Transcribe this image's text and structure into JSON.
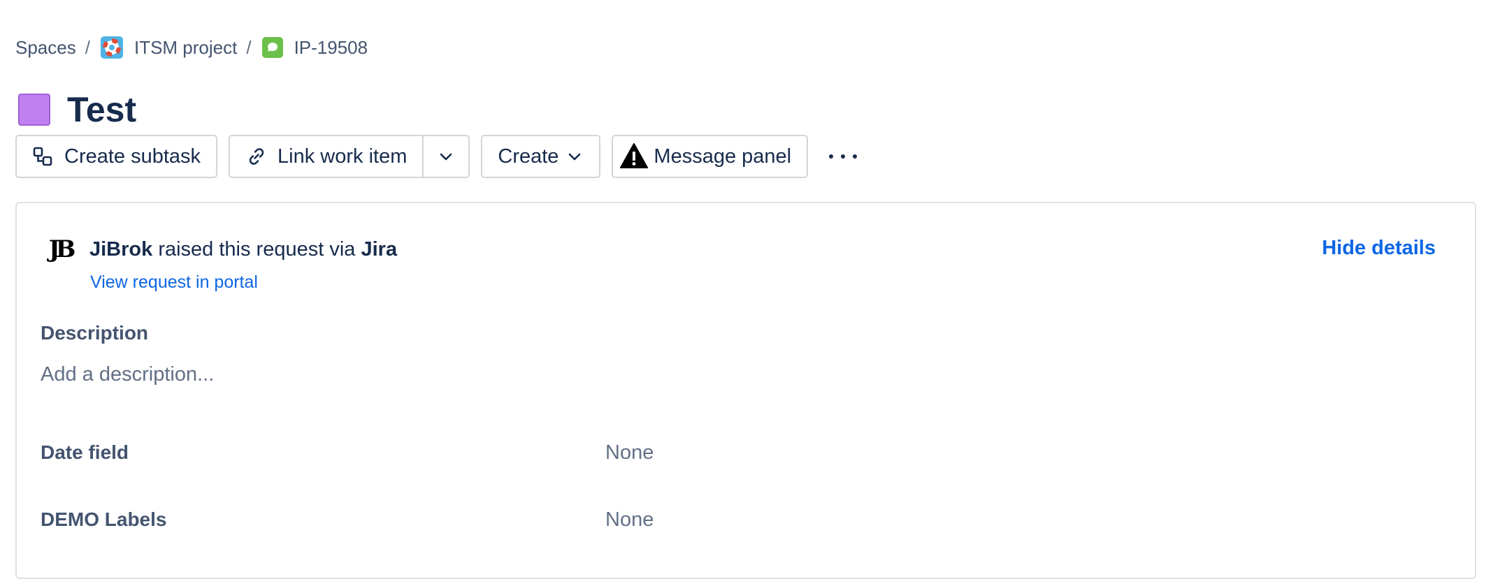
{
  "breadcrumb": {
    "spaces": "Spaces",
    "separator": "/",
    "project": "ITSM project",
    "project_icon": "lifebuoy-icon",
    "issue_key": "IP-19508",
    "issue_icon": "speech-bubble-icon"
  },
  "issue": {
    "title": "Test",
    "type_color": "#c081f0"
  },
  "toolbar": {
    "create_subtask": "Create subtask",
    "link_work_item": "Link work item",
    "create": "Create",
    "message_panel": "Message panel"
  },
  "request": {
    "reporter": "JiBrok",
    "raised_text": "raised this request via",
    "channel": "Jira",
    "view_portal": "View request in portal",
    "hide_details": "Hide details"
  },
  "description": {
    "label": "Description",
    "placeholder": "Add a description..."
  },
  "fields": [
    {
      "label": "Date field",
      "value": "None"
    },
    {
      "label": "DEMO Labels",
      "value": "None"
    }
  ],
  "colors": {
    "link": "#0c66e4",
    "text": "#172b4d",
    "subtle_text": "#626f86",
    "border": "#d3d5d9"
  }
}
